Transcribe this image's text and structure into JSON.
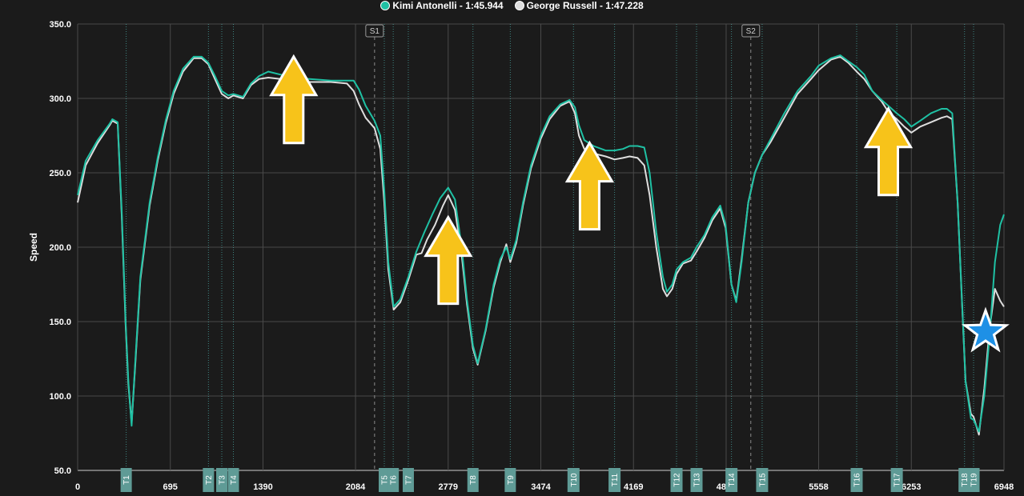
{
  "legend": [
    {
      "label": "Kimi Antonelli - 1:45.944",
      "color": "#1fc1a4"
    },
    {
      "label": "George Russell - 1:47.228",
      "color": "#dedede"
    }
  ],
  "chart_data": {
    "type": "line",
    "ylabel": "Speed",
    "xlabel": "",
    "xlim": [
      0,
      6948
    ],
    "ylim": [
      50,
      350
    ],
    "y_ticks": [
      "50.0",
      "100.0",
      "150.0",
      "200.0",
      "250.0",
      "300.0",
      "350.0"
    ],
    "x_ticks": [
      "0",
      "695",
      "1390",
      "2084",
      "2779",
      "3474",
      "4169",
      "4864",
      "5558",
      "6253",
      "6948"
    ],
    "grid": true,
    "legend_position": "top-center",
    "sectors": [
      {
        "label": "S1",
        "x": 2227
      },
      {
        "label": "S2",
        "x": 5049
      }
    ],
    "turns": [
      {
        "label": "T1",
        "x": 364
      },
      {
        "label": "T2",
        "x": 981
      },
      {
        "label": "T3",
        "x": 1081
      },
      {
        "label": "T4",
        "x": 1168
      },
      {
        "label": "T5",
        "x": 2300
      },
      {
        "label": "T6",
        "x": 2367
      },
      {
        "label": "T7",
        "x": 2480
      },
      {
        "label": "T8",
        "x": 2965
      },
      {
        "label": "T9",
        "x": 3245
      },
      {
        "label": "T10",
        "x": 3719
      },
      {
        "label": "T11",
        "x": 4027
      },
      {
        "label": "T12",
        "x": 4492
      },
      {
        "label": "T13",
        "x": 4642
      },
      {
        "label": "T14",
        "x": 4904
      },
      {
        "label": "T15",
        "x": 5134
      },
      {
        "label": "T16",
        "x": 5843
      },
      {
        "label": "T17",
        "x": 6144
      },
      {
        "label": "T18",
        "x": 6652
      },
      {
        "label": "T19",
        "x": 6720
      }
    ],
    "series": [
      {
        "name": "Kimi Antonelli - 1:45.944",
        "color": "#1fc1a4",
        "points": [
          [
            0,
            235
          ],
          [
            60,
            258
          ],
          [
            150,
            272
          ],
          [
            240,
            283
          ],
          [
            260,
            286
          ],
          [
            300,
            284
          ],
          [
            330,
            225
          ],
          [
            360,
            150
          ],
          [
            380,
            110
          ],
          [
            405,
            80
          ],
          [
            430,
            120
          ],
          [
            470,
            180
          ],
          [
            540,
            230
          ],
          [
            600,
            260
          ],
          [
            660,
            285
          ],
          [
            720,
            305
          ],
          [
            790,
            320
          ],
          [
            870,
            328
          ],
          [
            930,
            328
          ],
          [
            980,
            324
          ],
          [
            1030,
            315
          ],
          [
            1081,
            305
          ],
          [
            1130,
            302
          ],
          [
            1168,
            303
          ],
          [
            1240,
            301
          ],
          [
            1300,
            310
          ],
          [
            1360,
            315
          ],
          [
            1430,
            318
          ],
          [
            1520,
            316
          ],
          [
            1620,
            314
          ],
          [
            1740,
            313
          ],
          [
            1900,
            312
          ],
          [
            2070,
            312
          ],
          [
            2110,
            306
          ],
          [
            2160,
            295
          ],
          [
            2227,
            285
          ],
          [
            2270,
            275
          ],
          [
            2300,
            238
          ],
          [
            2330,
            190
          ],
          [
            2370,
            160
          ],
          [
            2420,
            165
          ],
          [
            2480,
            180
          ],
          [
            2540,
            197
          ],
          [
            2600,
            210
          ],
          [
            2660,
            222
          ],
          [
            2720,
            233
          ],
          [
            2779,
            240
          ],
          [
            2830,
            232
          ],
          [
            2880,
            200
          ],
          [
            2920,
            165
          ],
          [
            2965,
            134
          ],
          [
            3000,
            122
          ],
          [
            3060,
            145
          ],
          [
            3120,
            175
          ],
          [
            3170,
            192
          ],
          [
            3215,
            200
          ],
          [
            3245,
            192
          ],
          [
            3290,
            205
          ],
          [
            3340,
            230
          ],
          [
            3400,
            255
          ],
          [
            3474,
            275
          ],
          [
            3540,
            288
          ],
          [
            3620,
            296
          ],
          [
            3690,
            299
          ],
          [
            3730,
            294
          ],
          [
            3760,
            282
          ],
          [
            3800,
            272
          ],
          [
            3870,
            268
          ],
          [
            3960,
            265
          ],
          [
            4027,
            265
          ],
          [
            4090,
            266
          ],
          [
            4140,
            268
          ],
          [
            4200,
            268
          ],
          [
            4250,
            267
          ],
          [
            4290,
            250
          ],
          [
            4340,
            210
          ],
          [
            4390,
            180
          ],
          [
            4420,
            170
          ],
          [
            4460,
            175
          ],
          [
            4492,
            185
          ],
          [
            4540,
            190
          ],
          [
            4600,
            193
          ],
          [
            4642,
            200
          ],
          [
            4700,
            208
          ],
          [
            4760,
            220
          ],
          [
            4820,
            228
          ],
          [
            4860,
            215
          ],
          [
            4904,
            175
          ],
          [
            4940,
            163
          ],
          [
            4980,
            190
          ],
          [
            5030,
            230
          ],
          [
            5080,
            250
          ],
          [
            5134,
            262
          ],
          [
            5200,
            273
          ],
          [
            5300,
            290
          ],
          [
            5400,
            305
          ],
          [
            5500,
            315
          ],
          [
            5558,
            322
          ],
          [
            5650,
            327
          ],
          [
            5720,
            329
          ],
          [
            5780,
            325
          ],
          [
            5843,
            321
          ],
          [
            5900,
            316
          ],
          [
            5960,
            305
          ],
          [
            6030,
            299
          ],
          [
            6080,
            295
          ],
          [
            6144,
            290
          ],
          [
            6200,
            286
          ],
          [
            6253,
            281
          ],
          [
            6320,
            285
          ],
          [
            6400,
            290
          ],
          [
            6480,
            293
          ],
          [
            6520,
            293
          ],
          [
            6560,
            290
          ],
          [
            6600,
            230
          ],
          [
            6630,
            170
          ],
          [
            6660,
            110
          ],
          [
            6700,
            85
          ],
          [
            6720,
            84
          ],
          [
            6760,
            76
          ],
          [
            6800,
            100
          ],
          [
            6840,
            140
          ],
          [
            6880,
            190
          ],
          [
            6920,
            215
          ],
          [
            6948,
            222
          ]
        ]
      },
      {
        "name": "George Russell - 1:47.228",
        "color": "#dedede",
        "points": [
          [
            0,
            230
          ],
          [
            60,
            255
          ],
          [
            150,
            270
          ],
          [
            240,
            282
          ],
          [
            260,
            285
          ],
          [
            300,
            283
          ],
          [
            330,
            222
          ],
          [
            360,
            148
          ],
          [
            380,
            108
          ],
          [
            405,
            82
          ],
          [
            430,
            118
          ],
          [
            470,
            178
          ],
          [
            540,
            228
          ],
          [
            600,
            258
          ],
          [
            660,
            283
          ],
          [
            720,
            303
          ],
          [
            790,
            318
          ],
          [
            870,
            327
          ],
          [
            930,
            327
          ],
          [
            980,
            323
          ],
          [
            1030,
            313
          ],
          [
            1081,
            303
          ],
          [
            1130,
            300
          ],
          [
            1168,
            302
          ],
          [
            1240,
            300
          ],
          [
            1300,
            309
          ],
          [
            1360,
            313
          ],
          [
            1430,
            314
          ],
          [
            1520,
            313
          ],
          [
            1620,
            312
          ],
          [
            1740,
            311
          ],
          [
            1900,
            311
          ],
          [
            2020,
            310
          ],
          [
            2070,
            305
          ],
          [
            2110,
            296
          ],
          [
            2160,
            287
          ],
          [
            2227,
            280
          ],
          [
            2270,
            266
          ],
          [
            2300,
            230
          ],
          [
            2330,
            185
          ],
          [
            2370,
            158
          ],
          [
            2420,
            163
          ],
          [
            2480,
            178
          ],
          [
            2540,
            195
          ],
          [
            2580,
            196
          ],
          [
            2620,
            205
          ],
          [
            2680,
            215
          ],
          [
            2740,
            228
          ],
          [
            2779,
            235
          ],
          [
            2830,
            225
          ],
          [
            2880,
            195
          ],
          [
            2920,
            162
          ],
          [
            2965,
            132
          ],
          [
            3000,
            121
          ],
          [
            3060,
            144
          ],
          [
            3120,
            173
          ],
          [
            3170,
            190
          ],
          [
            3215,
            202
          ],
          [
            3245,
            190
          ],
          [
            3290,
            203
          ],
          [
            3340,
            228
          ],
          [
            3400,
            253
          ],
          [
            3474,
            273
          ],
          [
            3540,
            286
          ],
          [
            3620,
            295
          ],
          [
            3690,
            298
          ],
          [
            3730,
            290
          ],
          [
            3760,
            275
          ],
          [
            3800,
            266
          ],
          [
            3870,
            263
          ],
          [
            3960,
            261
          ],
          [
            4027,
            259
          ],
          [
            4090,
            260
          ],
          [
            4140,
            261
          ],
          [
            4200,
            260
          ],
          [
            4250,
            255
          ],
          [
            4290,
            235
          ],
          [
            4340,
            200
          ],
          [
            4390,
            172
          ],
          [
            4420,
            167
          ],
          [
            4460,
            172
          ],
          [
            4492,
            182
          ],
          [
            4540,
            189
          ],
          [
            4600,
            191
          ],
          [
            4642,
            197
          ],
          [
            4700,
            206
          ],
          [
            4760,
            218
          ],
          [
            4820,
            226
          ],
          [
            4860,
            213
          ],
          [
            4904,
            175
          ],
          [
            4940,
            164
          ],
          [
            4980,
            192
          ],
          [
            5030,
            230
          ],
          [
            5080,
            250
          ],
          [
            5134,
            262
          ],
          [
            5200,
            271
          ],
          [
            5300,
            287
          ],
          [
            5400,
            303
          ],
          [
            5500,
            313
          ],
          [
            5558,
            319
          ],
          [
            5650,
            326
          ],
          [
            5720,
            328
          ],
          [
            5780,
            324
          ],
          [
            5843,
            318
          ],
          [
            5900,
            313
          ],
          [
            5960,
            305
          ],
          [
            6030,
            298
          ],
          [
            6080,
            291
          ],
          [
            6144,
            286
          ],
          [
            6200,
            281
          ],
          [
            6253,
            277
          ],
          [
            6320,
            281
          ],
          [
            6400,
            284
          ],
          [
            6480,
            287
          ],
          [
            6520,
            288
          ],
          [
            6560,
            286
          ],
          [
            6600,
            230
          ],
          [
            6630,
            170
          ],
          [
            6660,
            110
          ],
          [
            6700,
            88
          ],
          [
            6720,
            86
          ],
          [
            6760,
            74
          ],
          [
            6800,
            105
          ],
          [
            6840,
            145
          ],
          [
            6880,
            172
          ],
          [
            6920,
            164
          ],
          [
            6948,
            160
          ]
        ]
      }
    ],
    "annotations": [
      {
        "type": "arrow-up",
        "color": "#f7c31a",
        "x": 1620,
        "y": 298
      },
      {
        "type": "arrow-up",
        "color": "#f7c31a",
        "x": 2779,
        "y": 190
      },
      {
        "type": "arrow-up",
        "color": "#f7c31a",
        "x": 3840,
        "y": 240
      },
      {
        "type": "arrow-up",
        "color": "#f7c31a",
        "x": 6080,
        "y": 263
      },
      {
        "type": "star",
        "color": "#1e90e6",
        "x": 6810,
        "y": 143
      }
    ]
  }
}
